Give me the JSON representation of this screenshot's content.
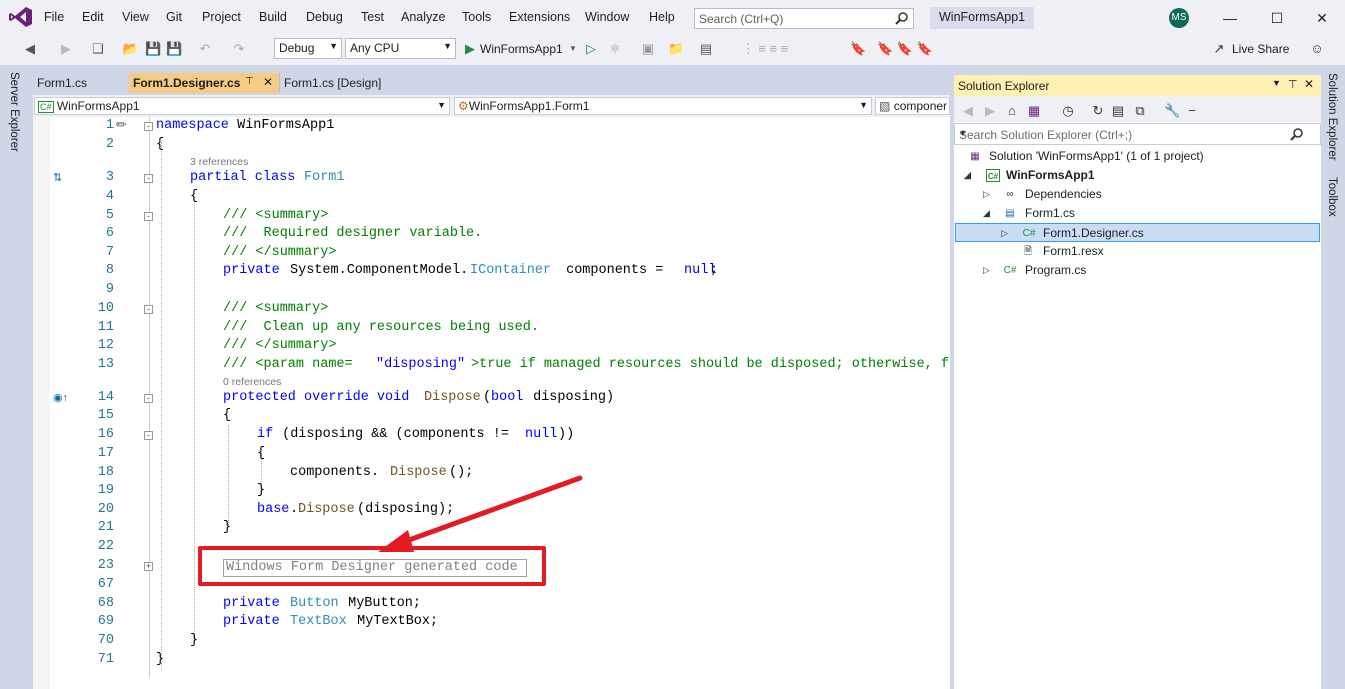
{
  "menubar": {
    "items": [
      "File",
      "Edit",
      "View",
      "Git",
      "Project",
      "Build",
      "Debug",
      "Test",
      "Analyze",
      "Tools",
      "Extensions",
      "Window",
      "Help"
    ],
    "search_placeholder": "Search (Ctrl+Q)",
    "app_title": "WinFormsApp1",
    "avatar_initials": "MS"
  },
  "toolbar": {
    "config": "Debug",
    "platform": "Any CPU",
    "run_label": "WinFormsApp1",
    "live_share": "Live Share"
  },
  "side": {
    "server_explorer": "Server Explorer",
    "solution_explorer_tab": "Solution Explorer",
    "toolbox": "Toolbox"
  },
  "editor": {
    "tabs": [
      "Form1.cs",
      "Form1.Designer.cs",
      "Form1.cs [Design]"
    ],
    "nav_project": "WinFormsApp1",
    "nav_class": "WinFormsApp1.Form1",
    "nav_member": "componer",
    "refs3": "3 references",
    "refs0": "0 references",
    "lines": {
      "n1": "1",
      "n2": "2",
      "n3": "3",
      "n4": "4",
      "n5": "5",
      "n6": "6",
      "n7": "7",
      "n8": "8",
      "n9": "9",
      "n10": "10",
      "n11": "11",
      "n12": "12",
      "n13": "13",
      "n14": "14",
      "n15": "15",
      "n16": "16",
      "n17": "17",
      "n18": "18",
      "n19": "19",
      "n20": "20",
      "n21": "21",
      "n22": "22",
      "n23": "23",
      "n67": "67",
      "n68": "68",
      "n69": "69",
      "n70": "70",
      "n71": "71"
    },
    "code": {
      "ns_kw": "namespace",
      "ns_name": " WinFormsApp1",
      "brace_open": "{",
      "brace_close": "}",
      "partial": "partial class ",
      "form1": "Form1",
      "sum_open": "/// <summary>",
      "req": "///  Required designer variable.",
      "sum_close": "/// </summary>",
      "private": "private ",
      "sys_cm": "System.ComponentModel.",
      "icontainer": "IContainer",
      "comp_null": " components = ",
      "null": "null",
      "semi": ";",
      "clean": "///  Clean up any resources being used.",
      "param_a": "/// <param name=",
      "param_b": "\"disposing\"",
      "param_c": ">true if managed resources should be disposed; otherwise, fa",
      "prot": "protected override void ",
      "dispose": "Dispose",
      "bool_open": "(",
      "bool_kw": "bool",
      " disposing": " disposing)",
      "if_kw": "if",
      " if_rest": " (disposing && (components != ",
      "close2": "))",
      "comp_dot": "components.",
      "dispose_call": "();",
      "base_kw": "base",
      "base_rest": ".",
      "disposing_call": "(disposing);",
      "region": "Windows Form Designer generated code",
      "button_t": "Button",
      "my_button": " MyButton;",
      "textbox_t": "TextBox",
      "my_textbox": " MyTextBox;"
    }
  },
  "solution_explorer": {
    "title": "Solution Explorer",
    "search_placeholder": "Search Solution Explorer (Ctrl+;)",
    "solution": "Solution 'WinFormsApp1' (1 of 1 project)",
    "project": "WinFormsApp1",
    "dependencies": "Dependencies",
    "form1cs": "Form1.cs",
    "designer": "Form1.Designer.cs",
    "resx": "Form1.resx",
    "program": "Program.cs"
  },
  "colors": {
    "accent": "#68217a",
    "highlight_red": "#e31b23",
    "selection": "#c9def5"
  }
}
